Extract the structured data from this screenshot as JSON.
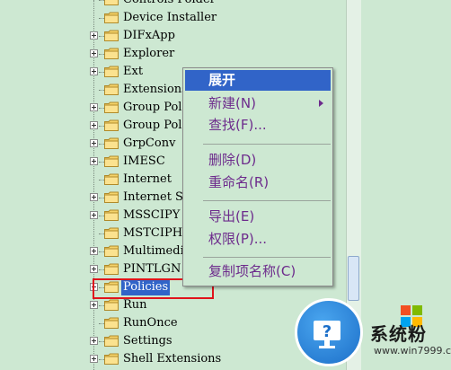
{
  "tree": {
    "rows": [
      {
        "label": "Controls Folder",
        "expander": false
      },
      {
        "label": "Device Installer",
        "expander": false
      },
      {
        "label": "DIFxApp",
        "expander": true
      },
      {
        "label": "Explorer",
        "expander": true
      },
      {
        "label": "Ext",
        "expander": true
      },
      {
        "label": "Extensions",
        "expander": false
      },
      {
        "label": "Group Pol",
        "expander": true
      },
      {
        "label": "Group Pol",
        "expander": true
      },
      {
        "label": "GrpConv",
        "expander": true
      },
      {
        "label": "IMESC",
        "expander": true
      },
      {
        "label": "Internet",
        "expander": false
      },
      {
        "label": "Internet Se",
        "expander": true
      },
      {
        "label": "MSSCIPY",
        "expander": true
      },
      {
        "label": "MSTCIPH",
        "expander": false
      },
      {
        "label": "Multimedia",
        "expander": true
      },
      {
        "label": "PINTLGN",
        "expander": true
      },
      {
        "label": "Policies",
        "expander": true,
        "selected": true
      },
      {
        "label": "Run",
        "expander": true
      },
      {
        "label": "RunOnce",
        "expander": false
      },
      {
        "label": "Settings",
        "expander": true
      },
      {
        "label": "Shell Extensions",
        "expander": true
      }
    ]
  },
  "context_menu": {
    "items": [
      {
        "label": "展开",
        "highlighted": true
      },
      {
        "label": "新建(N)",
        "submenu": true
      },
      {
        "label": "查找(F)..."
      },
      {
        "label": "删除(D)"
      },
      {
        "label": "重命名(R)"
      },
      {
        "label": "导出(E)"
      },
      {
        "label": "权限(P)..."
      },
      {
        "label": "复制项名称(C)"
      }
    ]
  },
  "watermark": {
    "brand": "系统粉",
    "url": "www.win7999.com",
    "colors": {
      "red": "#f25022",
      "green": "#7fba00",
      "blue": "#00a4ef",
      "yellow": "#ffb900"
    }
  },
  "colors": {
    "background": "#cde8d2",
    "selection": "#3164c8",
    "menu_text": "#6d2b8c",
    "highlight_border": "#e0141c"
  }
}
